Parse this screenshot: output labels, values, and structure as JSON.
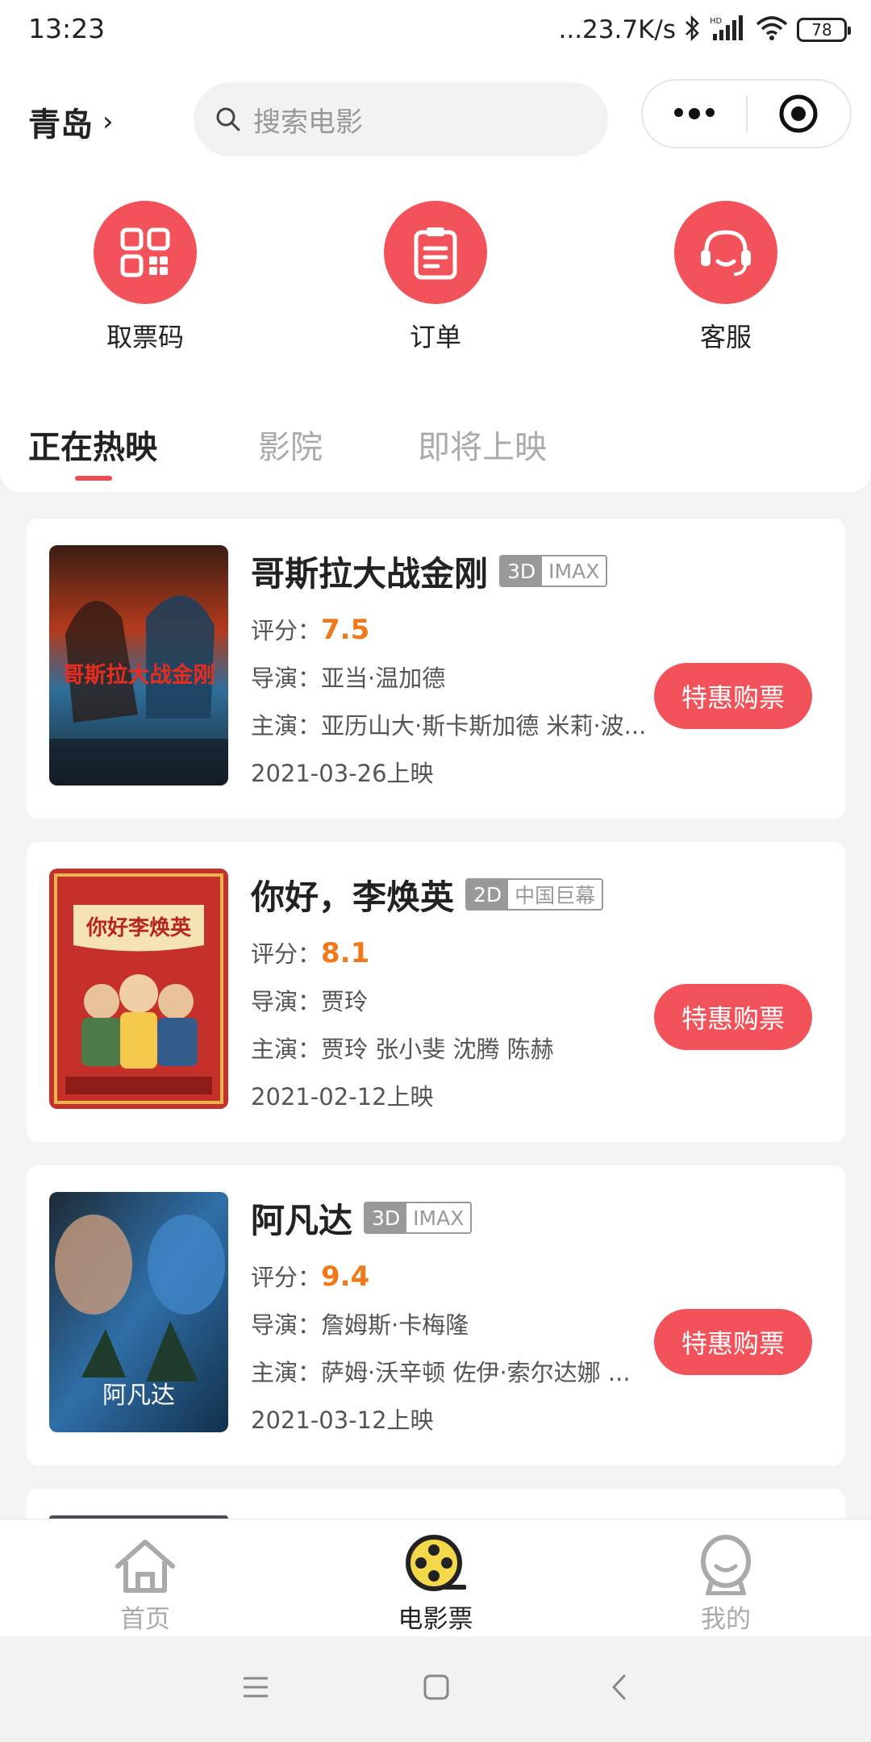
{
  "status_bar": {
    "time": "13:23",
    "network_speed": "...23.7K/s",
    "battery": "78"
  },
  "header": {
    "city": "青岛",
    "search_placeholder": "搜索电影"
  },
  "quick_actions": [
    {
      "label": "取票码",
      "icon": "qrcode-icon"
    },
    {
      "label": "订单",
      "icon": "clipboard-icon"
    },
    {
      "label": "客服",
      "icon": "headset-icon"
    }
  ],
  "tabs": [
    {
      "label": "正在热映",
      "active": true
    },
    {
      "label": "影院",
      "active": false
    },
    {
      "label": "即将上映",
      "active": false
    }
  ],
  "movies": [
    {
      "title": "哥斯拉大战金刚",
      "dimension": "3D",
      "screen": "IMAX",
      "score_label": "评分：",
      "score": "7.5",
      "director_label": "导演：",
      "director": "亚当·温加德",
      "actors_label": "主演：",
      "actors": "亚历山大·斯卡斯加德 米莉·波...",
      "release": "2021-03-26上映",
      "button": "特惠购票",
      "poster_text": "哥斯拉大战金刚"
    },
    {
      "title": "你好，李焕英",
      "dimension": "2D",
      "screen": "中国巨幕",
      "score_label": "评分：",
      "score": "8.1",
      "director_label": "导演：",
      "director": "贾玲",
      "actors_label": "主演：",
      "actors": "贾玲 张小斐 沈腾 陈赫",
      "release": "2021-02-12上映",
      "button": "特惠购票",
      "poster_text": "你好李焕英"
    },
    {
      "title": "阿凡达",
      "dimension": "3D",
      "screen": "IMAX",
      "score_label": "评分：",
      "score": "9.4",
      "director_label": "导演：",
      "director": "詹姆斯·卡梅隆",
      "actors_label": "主演：",
      "actors": "萨姆·沃辛顿 佐伊·索尔达娜 ...",
      "release": "2021-03-12上映",
      "button": "特惠购票",
      "poster_text": "阿凡达"
    }
  ],
  "bottom_nav": [
    {
      "label": "首页",
      "icon": "home-icon",
      "active": false
    },
    {
      "label": "电影票",
      "icon": "film-reel-icon",
      "active": true
    },
    {
      "label": "我的",
      "icon": "profile-icon",
      "active": false
    }
  ],
  "colors": {
    "accent": "#f2525a",
    "score": "#f07a1b",
    "tab_underline": "#e94e53"
  }
}
